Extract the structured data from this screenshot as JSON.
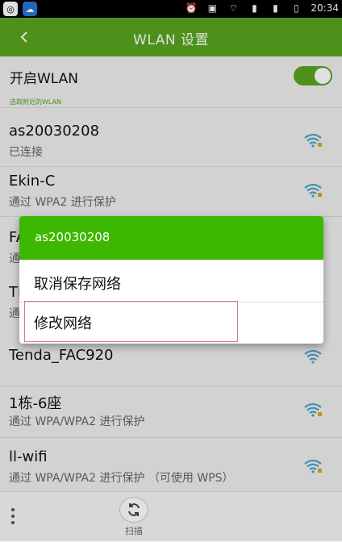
{
  "statusbar": {
    "time": "20:34",
    "icons": [
      "camera-icon",
      "cloud-icon",
      "alarm-icon",
      "nfc-icon",
      "wifi-icon",
      "sim1-icon",
      "sim2-icon",
      "battery-icon"
    ]
  },
  "header": {
    "title": "WLAN 设置"
  },
  "toggle": {
    "label": "开启WLAN",
    "on": true
  },
  "section_title": "选取附近的WLAN",
  "networks": [
    {
      "name": "as20030208",
      "status": "已连接"
    },
    {
      "name": "Ekin-C",
      "status": "通过 WPA2 进行保护"
    },
    {
      "name": "FA",
      "status": "通"
    },
    {
      "name": "Tl",
      "status": "通"
    },
    {
      "name": "Tenda_FAC920",
      "status": ""
    },
    {
      "name": "1栋-6座",
      "status": "通过 WPA/WPA2 进行保护"
    },
    {
      "name": "ll-wifi",
      "status": "通过 WPA/WPA2 进行保护 （可使用 WPS）"
    }
  ],
  "dialog": {
    "title": "as20030208",
    "options": [
      "取消保存网络",
      "修改网络"
    ],
    "selected_index": 1
  },
  "footer": {
    "scan_label": "扫描"
  },
  "colors": {
    "accent": "#58a51e",
    "dialog_head": "#3cb702",
    "wifi": "#4aa6c8",
    "lock": "#e0a526"
  }
}
